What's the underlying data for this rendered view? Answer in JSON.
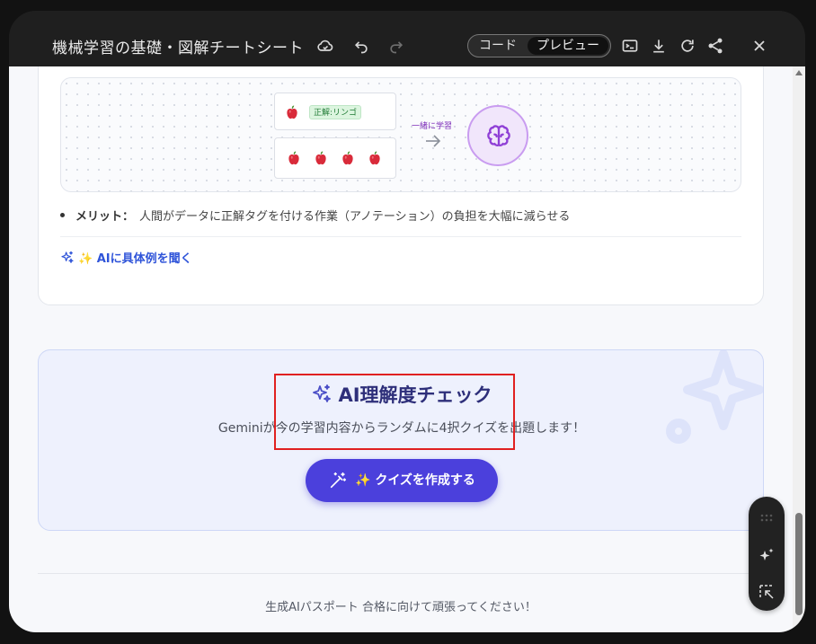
{
  "window": {
    "title": "機械学習の基礎・図解チートシート",
    "view_toggle": {
      "code_label": "コード",
      "preview_label": "プレビュー",
      "selected": "プレビュー"
    }
  },
  "diagram": {
    "label_tag": "正解:リンゴ",
    "learn_label": "一緒に学習",
    "apple_count": 4
  },
  "merit": {
    "label": "メリット：",
    "text": "人間がデータに正解タグを付ける作業（アノテーション）の負担を大幅に減らせる"
  },
  "ai_link": {
    "label": "✨ AIに具体例を聞く"
  },
  "quiz": {
    "title": "AI理解度チェック",
    "description": "Geminiが今の学習内容からランダムに4択クイズを出題します！",
    "button_label": "✨ クイズを作成する"
  },
  "footer": {
    "text": "生成AIパスポート 合格に向けて頑張ってください！"
  },
  "colors": {
    "accent": "#4b40dc",
    "highlight": "#e02020",
    "titlebar": "#1f1f1f"
  },
  "icons": {
    "titlebar": [
      "cloud-icon",
      "undo-icon",
      "redo-icon",
      "terminal-icon",
      "download-icon",
      "refresh-icon",
      "share-icon",
      "close-icon"
    ],
    "floating": [
      "grid-icon",
      "sparkle-icon",
      "select-icon"
    ]
  }
}
